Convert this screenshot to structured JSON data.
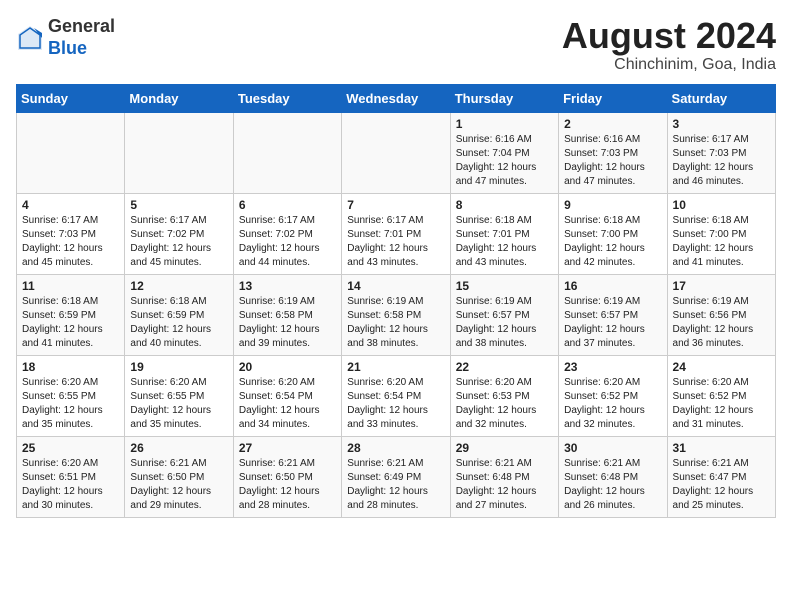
{
  "header": {
    "logo_general": "General",
    "logo_blue": "Blue",
    "title": "August 2024",
    "subtitle": "Chinchinim, Goa, India"
  },
  "weekdays": [
    "Sunday",
    "Monday",
    "Tuesday",
    "Wednesday",
    "Thursday",
    "Friday",
    "Saturday"
  ],
  "weeks": [
    [
      {
        "day": "",
        "info": ""
      },
      {
        "day": "",
        "info": ""
      },
      {
        "day": "",
        "info": ""
      },
      {
        "day": "",
        "info": ""
      },
      {
        "day": "1",
        "info": "Sunrise: 6:16 AM\nSunset: 7:04 PM\nDaylight: 12 hours\nand 47 minutes."
      },
      {
        "day": "2",
        "info": "Sunrise: 6:16 AM\nSunset: 7:03 PM\nDaylight: 12 hours\nand 47 minutes."
      },
      {
        "day": "3",
        "info": "Sunrise: 6:17 AM\nSunset: 7:03 PM\nDaylight: 12 hours\nand 46 minutes."
      }
    ],
    [
      {
        "day": "4",
        "info": "Sunrise: 6:17 AM\nSunset: 7:03 PM\nDaylight: 12 hours\nand 45 minutes."
      },
      {
        "day": "5",
        "info": "Sunrise: 6:17 AM\nSunset: 7:02 PM\nDaylight: 12 hours\nand 45 minutes."
      },
      {
        "day": "6",
        "info": "Sunrise: 6:17 AM\nSunset: 7:02 PM\nDaylight: 12 hours\nand 44 minutes."
      },
      {
        "day": "7",
        "info": "Sunrise: 6:17 AM\nSunset: 7:01 PM\nDaylight: 12 hours\nand 43 minutes."
      },
      {
        "day": "8",
        "info": "Sunrise: 6:18 AM\nSunset: 7:01 PM\nDaylight: 12 hours\nand 43 minutes."
      },
      {
        "day": "9",
        "info": "Sunrise: 6:18 AM\nSunset: 7:00 PM\nDaylight: 12 hours\nand 42 minutes."
      },
      {
        "day": "10",
        "info": "Sunrise: 6:18 AM\nSunset: 7:00 PM\nDaylight: 12 hours\nand 41 minutes."
      }
    ],
    [
      {
        "day": "11",
        "info": "Sunrise: 6:18 AM\nSunset: 6:59 PM\nDaylight: 12 hours\nand 41 minutes."
      },
      {
        "day": "12",
        "info": "Sunrise: 6:18 AM\nSunset: 6:59 PM\nDaylight: 12 hours\nand 40 minutes."
      },
      {
        "day": "13",
        "info": "Sunrise: 6:19 AM\nSunset: 6:58 PM\nDaylight: 12 hours\nand 39 minutes."
      },
      {
        "day": "14",
        "info": "Sunrise: 6:19 AM\nSunset: 6:58 PM\nDaylight: 12 hours\nand 38 minutes."
      },
      {
        "day": "15",
        "info": "Sunrise: 6:19 AM\nSunset: 6:57 PM\nDaylight: 12 hours\nand 38 minutes."
      },
      {
        "day": "16",
        "info": "Sunrise: 6:19 AM\nSunset: 6:57 PM\nDaylight: 12 hours\nand 37 minutes."
      },
      {
        "day": "17",
        "info": "Sunrise: 6:19 AM\nSunset: 6:56 PM\nDaylight: 12 hours\nand 36 minutes."
      }
    ],
    [
      {
        "day": "18",
        "info": "Sunrise: 6:20 AM\nSunset: 6:55 PM\nDaylight: 12 hours\nand 35 minutes."
      },
      {
        "day": "19",
        "info": "Sunrise: 6:20 AM\nSunset: 6:55 PM\nDaylight: 12 hours\nand 35 minutes."
      },
      {
        "day": "20",
        "info": "Sunrise: 6:20 AM\nSunset: 6:54 PM\nDaylight: 12 hours\nand 34 minutes."
      },
      {
        "day": "21",
        "info": "Sunrise: 6:20 AM\nSunset: 6:54 PM\nDaylight: 12 hours\nand 33 minutes."
      },
      {
        "day": "22",
        "info": "Sunrise: 6:20 AM\nSunset: 6:53 PM\nDaylight: 12 hours\nand 32 minutes."
      },
      {
        "day": "23",
        "info": "Sunrise: 6:20 AM\nSunset: 6:52 PM\nDaylight: 12 hours\nand 32 minutes."
      },
      {
        "day": "24",
        "info": "Sunrise: 6:20 AM\nSunset: 6:52 PM\nDaylight: 12 hours\nand 31 minutes."
      }
    ],
    [
      {
        "day": "25",
        "info": "Sunrise: 6:20 AM\nSunset: 6:51 PM\nDaylight: 12 hours\nand 30 minutes."
      },
      {
        "day": "26",
        "info": "Sunrise: 6:21 AM\nSunset: 6:50 PM\nDaylight: 12 hours\nand 29 minutes."
      },
      {
        "day": "27",
        "info": "Sunrise: 6:21 AM\nSunset: 6:50 PM\nDaylight: 12 hours\nand 28 minutes."
      },
      {
        "day": "28",
        "info": "Sunrise: 6:21 AM\nSunset: 6:49 PM\nDaylight: 12 hours\nand 28 minutes."
      },
      {
        "day": "29",
        "info": "Sunrise: 6:21 AM\nSunset: 6:48 PM\nDaylight: 12 hours\nand 27 minutes."
      },
      {
        "day": "30",
        "info": "Sunrise: 6:21 AM\nSunset: 6:48 PM\nDaylight: 12 hours\nand 26 minutes."
      },
      {
        "day": "31",
        "info": "Sunrise: 6:21 AM\nSunset: 6:47 PM\nDaylight: 12 hours\nand 25 minutes."
      }
    ]
  ]
}
